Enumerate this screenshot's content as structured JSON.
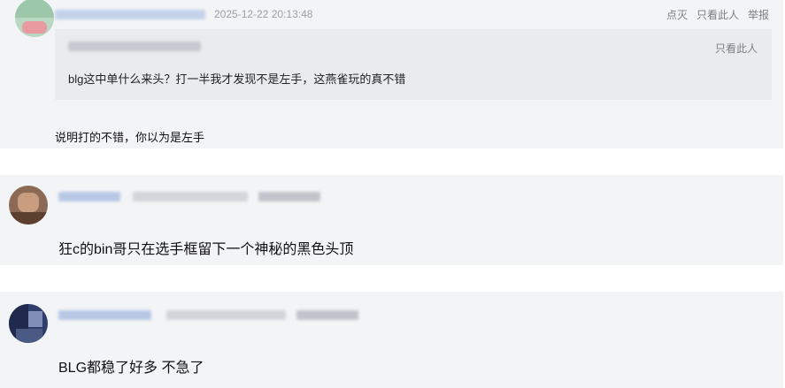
{
  "comments": [
    {
      "timestamp": "2025-12-22 20:13:48",
      "actions": [
        "点灭",
        "只看此人",
        "举报"
      ],
      "quote": {
        "only_this_person": "只看此人",
        "text": "blg这中单什么来头？打一半我才发现不是左手，这燕雀玩的真不错"
      },
      "reply_text": "说明打的不错，你以为是左手"
    },
    {
      "text": "狂c的bin哥只在选手框留下一个神秘的黑色头顶"
    },
    {
      "text": "BLG都稳了好多 不急了"
    }
  ]
}
